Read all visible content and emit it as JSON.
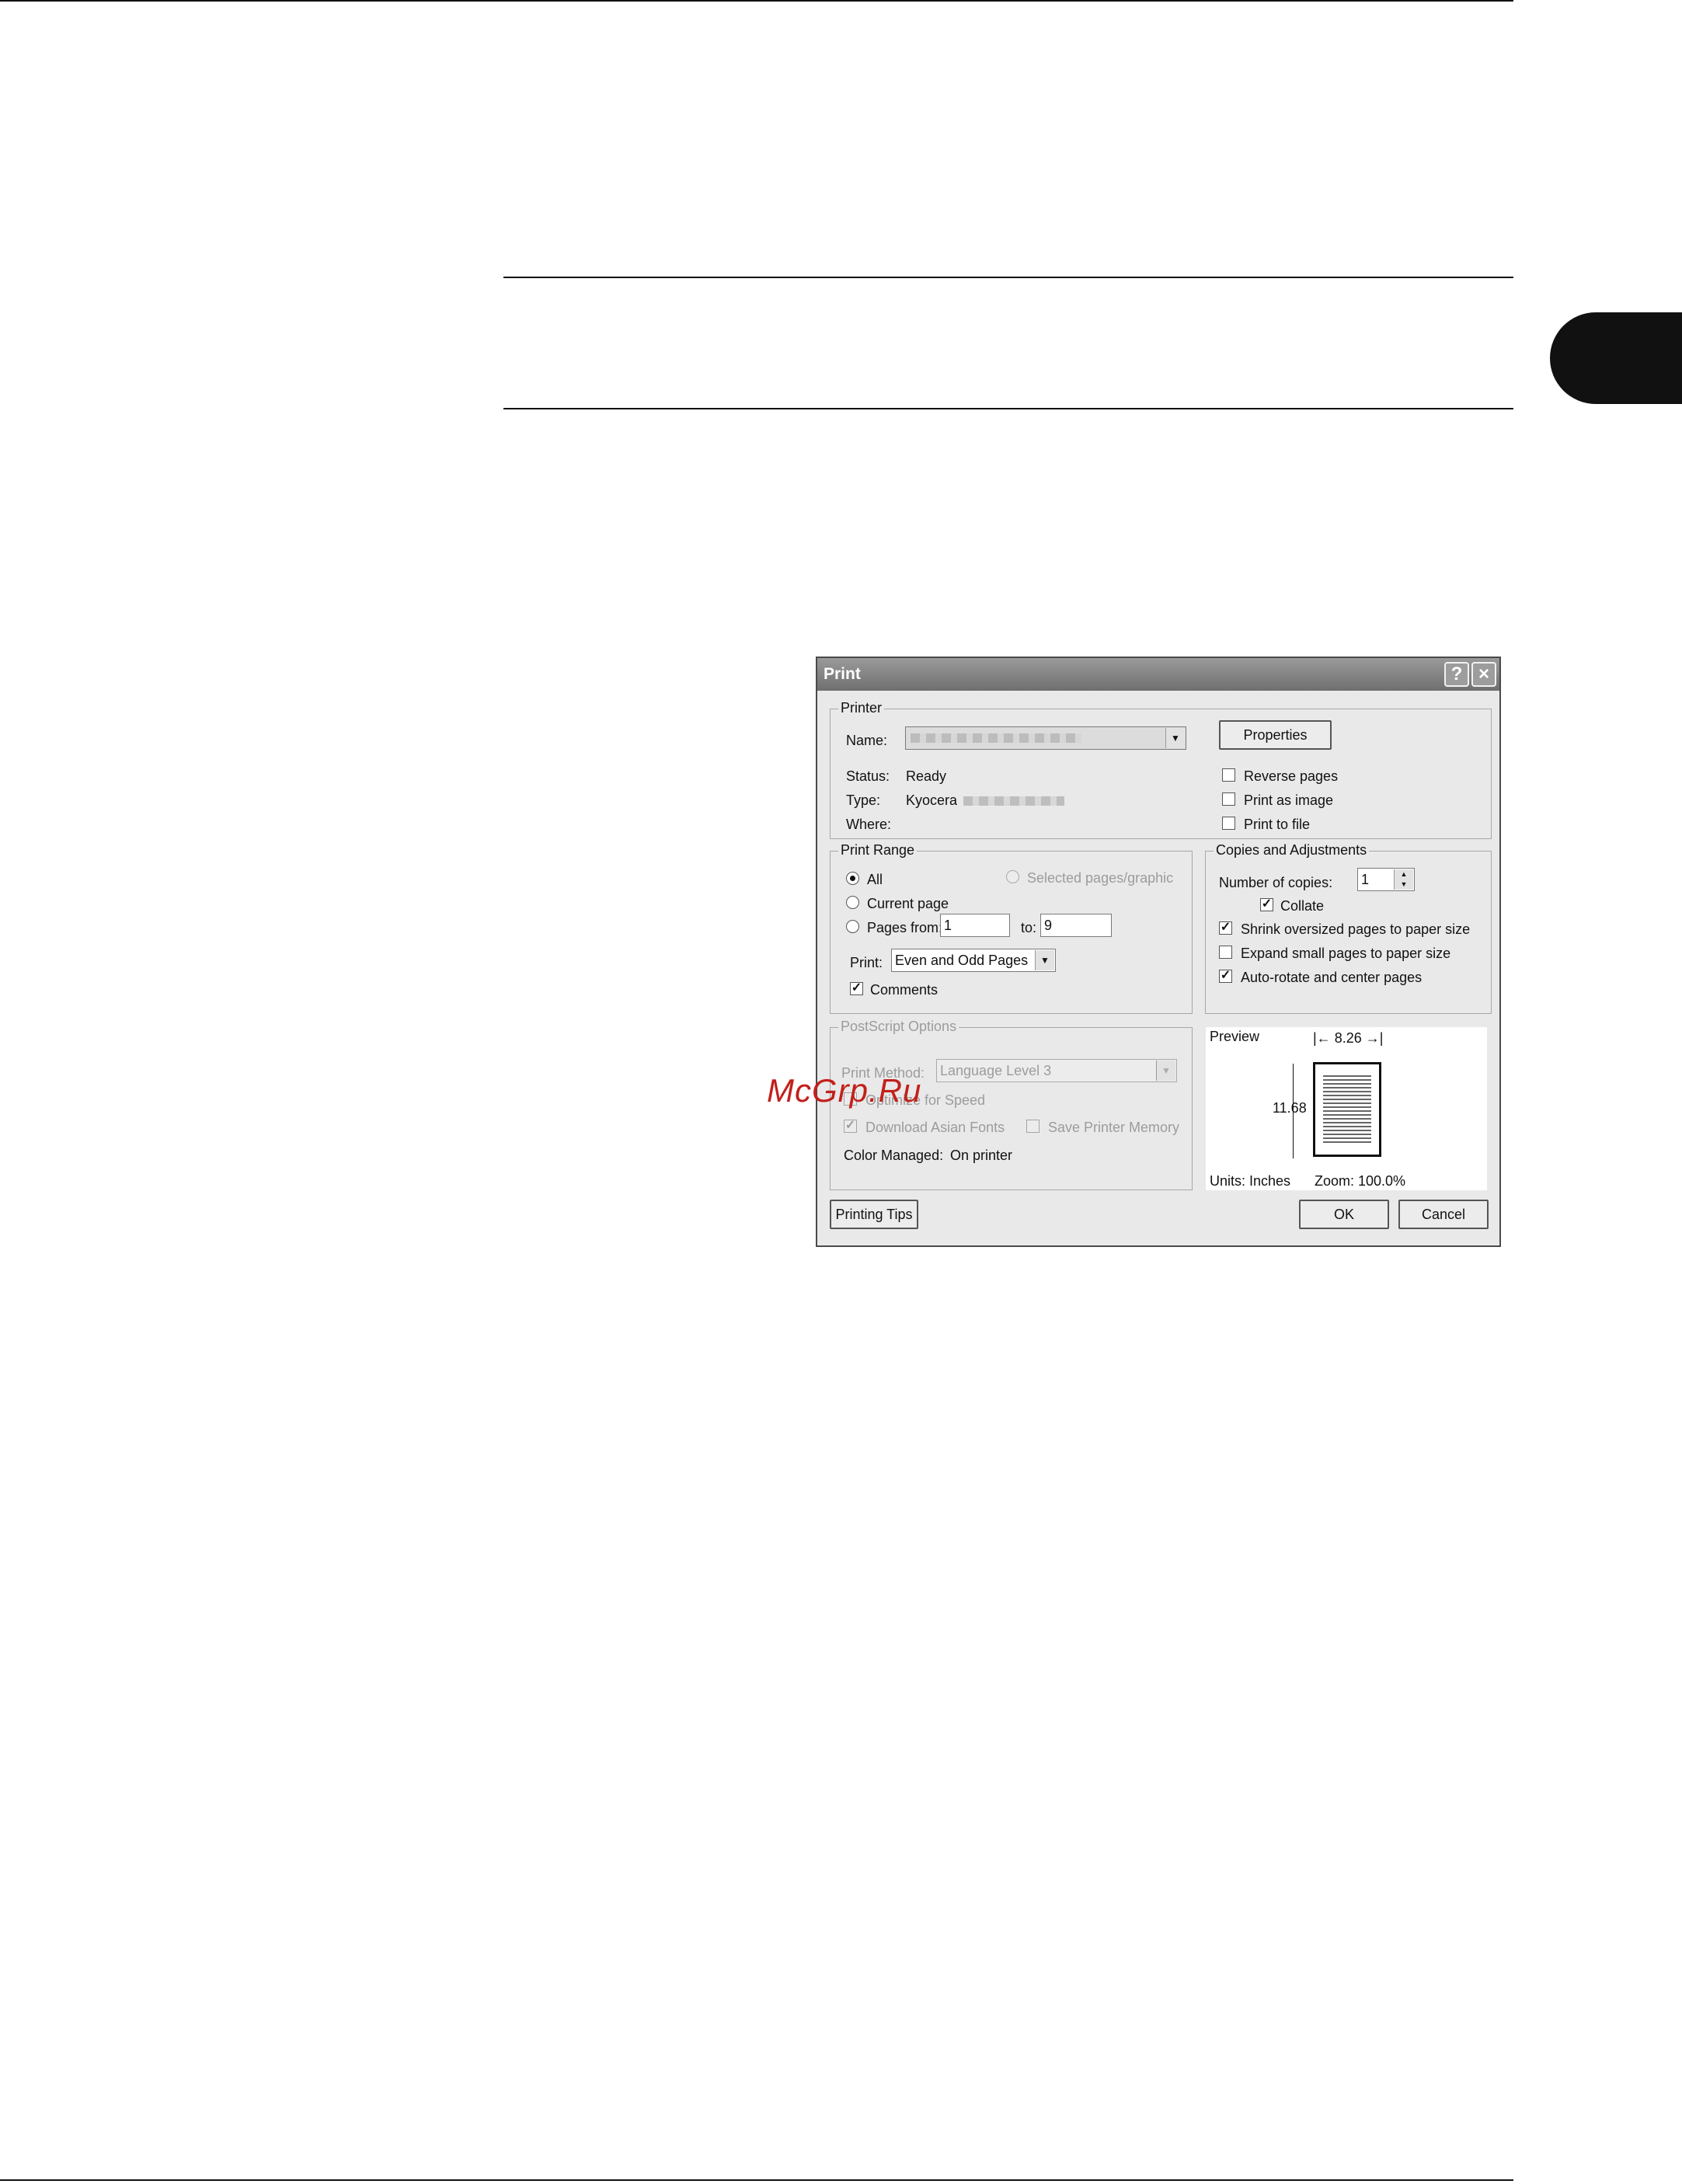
{
  "watermark": "McGrp.Ru",
  "dialog": {
    "title": "Print",
    "help_label": "?",
    "close_label": "×",
    "printer": {
      "group_label": "Printer",
      "name_label": "Name:",
      "status_label": "Status:",
      "status_value": "Ready",
      "type_label": "Type:",
      "type_value": "Kyocera",
      "where_label": "Where:",
      "properties_label": "Properties",
      "reverse_pages": {
        "label": "Reverse pages",
        "checked": false
      },
      "print_as_image": {
        "label": "Print as image",
        "checked": false
      },
      "print_to_file": {
        "label": "Print to file",
        "checked": false
      }
    },
    "print_range": {
      "group_label": "Print Range",
      "all_label": "All",
      "selected_label": "Selected pages/graphic",
      "current_page_label": "Current page",
      "pages_label": "Pages from:",
      "from_value": "1",
      "to_label": "to:",
      "to_value": "9",
      "print_label": "Print:",
      "print_value": "Even and Odd Pages",
      "comments_label": "Comments",
      "selected": "all"
    },
    "copies": {
      "group_label": "Copies and Adjustments",
      "number_label": "Number of copies:",
      "number_value": "1",
      "collate": {
        "label": "Collate",
        "checked": true
      },
      "shrink": {
        "label": "Shrink oversized pages to paper size",
        "checked": true
      },
      "expand": {
        "label": "Expand small pages to paper size",
        "checked": false
      },
      "autorotate": {
        "label": "Auto-rotate and center pages",
        "checked": true
      }
    },
    "postscript": {
      "group_label": "PostScript Options",
      "method_label": "Print Method:",
      "method_value": "Language Level 3",
      "optimize_label": "Optimize for Speed",
      "download_fonts_label": "Download Asian Fonts",
      "save_memory_label": "Save Printer Memory",
      "color_managed_label": "Color Managed:",
      "color_managed_value": "On printer"
    },
    "preview": {
      "label": "Preview",
      "width_value": "8.26",
      "height_value": "11.68",
      "units": "Units: Inches",
      "zoom": "Zoom: 100.0%"
    },
    "buttons": {
      "printing_tips": "Printing Tips",
      "ok": "OK",
      "cancel": "Cancel"
    }
  }
}
